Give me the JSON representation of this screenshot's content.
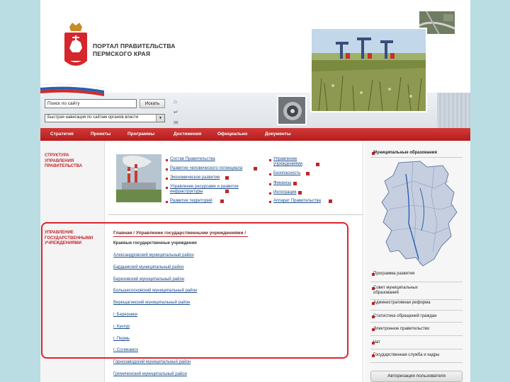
{
  "header": {
    "portal_title_line1": "ПОРТАЛ ПРАВИТЕЛЬСТВА",
    "portal_title_line2": "ПЕРМСКОГО КРАЯ"
  },
  "search": {
    "placeholder": "Поиск по сайту",
    "button_label": "Искать",
    "quick_nav": "Быстрая навигация по сайтам органов власти"
  },
  "nav": {
    "items": [
      "Стратегия",
      "Проекты",
      "Программы",
      "Достижения",
      "Официально",
      "Документы"
    ]
  },
  "left": {
    "section1_title": "СТРУКТУРА УПРАВЛЕНИЯ ПРАВИТЕЛЬСТВА",
    "section2_title": "УПРАВЛЕНИЕ ГОСУДАРСТВЕННЫМИ УЧРЕЖДЕНИЯМИ"
  },
  "structure_links": {
    "col1": [
      "Состав Правительства",
      "Развитие человеческого потенциала",
      "Экономическое развитие",
      "Управление ресурсами и развитие инфраструктуры",
      "Развитие территорий"
    ],
    "col2": [
      "Управление учреждениями",
      "Безопасность",
      "Финансы",
      "Интеграция",
      "Аппарат Правительства"
    ]
  },
  "institutions": {
    "breadcrumb": "Главная / Управление государственными учреждениями /",
    "subtitle": "Краевые государственные учреждения",
    "districts": [
      "Александровский муниципальный район",
      "Бардымский муниципальный район",
      "Березовский муниципальный район",
      "Большесосновский муниципальный район",
      "Верещагинский муниципальный район",
      "г. Березники",
      "г. Кунгур",
      "г. Пермь",
      "г. Соликамск",
      "Горнозаводский муниципальный район",
      "Гремячинский муниципальный район"
    ]
  },
  "right": {
    "municipal": "Муниципальные образования",
    "items": [
      "Программа развития",
      "Совет муниципальных образований",
      "Административная реформа",
      "Статистика обращений граждан",
      "Электронное правительство",
      "Чат",
      "Государственная служба и кадры"
    ],
    "auth": "Авторизация пользователя"
  },
  "colors": {
    "accent": "#c0262b",
    "nav_bg": "#c22a2a",
    "link": "#1a4c8c",
    "highlight_border": "#e0242a"
  }
}
